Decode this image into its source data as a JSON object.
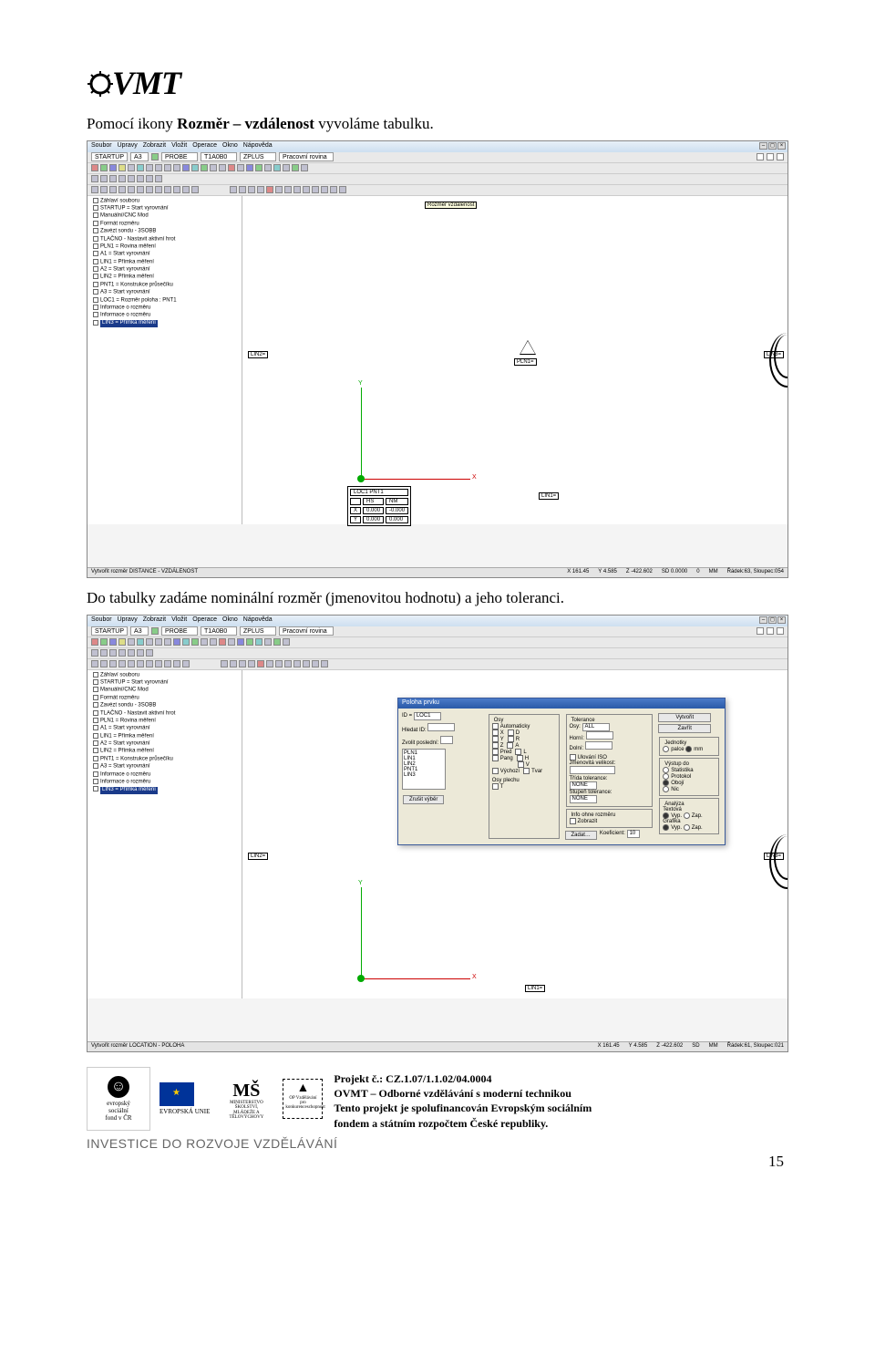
{
  "logo": "OVMT",
  "para1_a": "Pomocí ikony ",
  "para1_b": "Rozměr – vzdálenost",
  "para1_c": " vyvoláme tabulku.",
  "para2": "Do tabulky zadáme nominální rozměr (jmenovitou hodnotu) a jeho toleranci.",
  "app": {
    "menu": [
      "Soubor",
      "Úpravy",
      "Zobrazit",
      "Vložit",
      "Operace",
      "Okno",
      "Nápověda"
    ],
    "startup": "STARTUP",
    "a3": "A3",
    "probe": "PROBE",
    "t1": "T1A0B0",
    "zplus": "ZPLUS",
    "workplane": "Pracovní rovina",
    "tooltip": "Rozměr vzdálenost",
    "tree": [
      "Záhlaví souboru",
      "STARTUP = Start vyrovnání",
      "Manuální/CNC Mod",
      "Formát rozměru",
      "Zavézt sondu - 3SOBB",
      "TLAČNO - Nastavit aktivní hrot",
      "PLN1 = Rovina měření",
      "A1 = Start vyrovnání",
      "LIN1 = Přímka měření",
      "A2 = Start vyrovnání",
      "LIN2 = Přímka měření",
      "PNT1 = Konstrukce průsečíku",
      "A3 = Start vyrovnání",
      "LOC1 = Rozměr poloha : PNT1",
      "Informace o rozměru",
      "Informace o rozměru",
      "LIN3 = Přímka měření"
    ],
    "tags": {
      "lin2": "LIN2=",
      "pln1": "PLN1=",
      "lin3": "LIN3=",
      "lin1": "LIN1=",
      "loc1": "LOC1  PNT1"
    },
    "table": {
      "hs": "HS",
      "nm": "NM",
      "x": "X",
      "y": "Y",
      "v00": "0.000",
      "v01": "-0.000",
      "v10": "0.000",
      "v11": "0.000"
    },
    "status1_left": "Vytvořit rozměr DISTANCE - VZDÁLENOST",
    "status1": {
      "x": "X 161.45",
      "y": "Y  4.585",
      "z": "Z -422.602",
      "sd": "SD  0.0000",
      "zero": "0",
      "mm": "MM",
      "rc": "Řádek:63, Sloupec:054"
    },
    "status2_left": "Vytvořit rozměr LOCATION - POLOHA",
    "status2": {
      "x": "X 161.45",
      "y": "Y  4.585",
      "z": "Z -422.602",
      "sd": "SD",
      "mm": "MM",
      "rc": "Řádek:61, Sloupec:021"
    },
    "dialog": {
      "title": "Poloha prvku",
      "id_lbl": "ID =",
      "id_val": "LOC1",
      "hledat": "Hledat ID:",
      "zvolit": "Zvolit poslední:",
      "list": [
        "PLN1",
        "LIN1",
        "LIN2",
        "PNT1",
        "LIN3"
      ],
      "osy_title": "Osy",
      "osy": [
        "Automaticky",
        "X",
        "D",
        "Y",
        "R",
        "Z",
        "A",
        "Pred",
        "L",
        "Pang",
        "H",
        "V",
        "Výchozí",
        "Tvar",
        "T"
      ],
      "osy_plechu": "Osy plechu",
      "tol_title": "Tolerance",
      "osy_sel": "Osy:",
      "all": "ALL",
      "horni": "Horní:",
      "dolni": "Dolní:",
      "ul_iso": "Ulování ISO",
      "jm_vel": "Jmenovitá velikost:",
      "trida": "Třída tolerance:",
      "none": "NONE",
      "stupen": "Stupeň tolerance:",
      "vytvorit": "Vytvořit",
      "zavrit": "Zavřít",
      "jednotky": "Jednotky",
      "palce": "palce",
      "mm": "mm",
      "vystup": "Výstup do",
      "stat": "Statistika",
      "prot": "Protokol",
      "oboji": "Obojí",
      "nic": "Nic",
      "analyza": "Analýza",
      "textova": "Textová",
      "vyp": "Vyp.",
      "zap": "Zap.",
      "grafika": "Grafika",
      "info": "Info ohne rozměru",
      "zobrazit": "Zobrazit",
      "zrusit": "Zrušit výběr",
      "zadat": "Zadat…",
      "koef": "Koeficient:",
      "koef_v": "10"
    }
  },
  "footer": {
    "esf": "evropský\nsociální\nfond v ČR",
    "eu": "EVROPSKÁ UNIE",
    "msmt": "MINISTERSTVO ŠKOLSTVÍ,\nMLÁDEŽE A TĚLOVÝCHOVY",
    "opvk": "OP Vzdělávání\npro konkurenceschopnost",
    "investice": "INVESTICE DO ROZVOJE VZDĚLÁVÁNÍ",
    "proj_lbl": "Projekt č.: CZ.1.07/1.1.02/04.0004",
    "line2": "OVMT – Odborné vzdělávání s moderní technikou",
    "line3": "Tento projekt je spolufinancován Evropským sociálním",
    "line4": "fondem a státním rozpočtem České republiky."
  },
  "page_num": "15"
}
